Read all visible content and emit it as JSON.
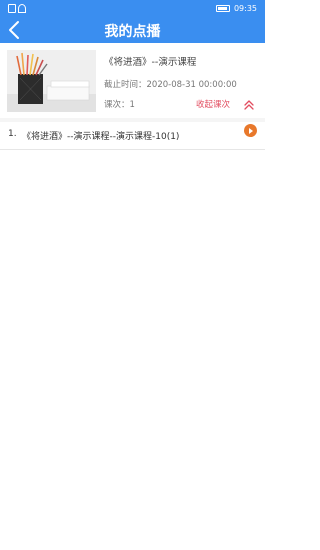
{
  "status_bar": {
    "time": "09:35"
  },
  "header": {
    "title": "我的点播"
  },
  "course": {
    "title": "《将进酒》--演示课程",
    "deadline": "截止时间：2020-08-31 00:00:00",
    "count": "课次：1",
    "collapse_label": "收起课次"
  },
  "lessons": [
    {
      "index": "1.",
      "title": "《将进酒》--演示课程--演示课程-10(1)"
    }
  ],
  "colors": {
    "primary": "#3a8ef0",
    "accent": "#e24d60",
    "play": "#e8782b"
  },
  "icons": {
    "back": "chevron-left",
    "collapse": "double-chevron-up",
    "play": "play-circle"
  }
}
